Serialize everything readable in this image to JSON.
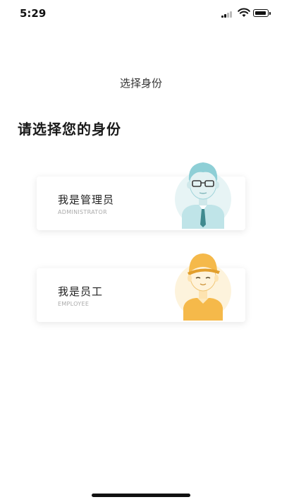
{
  "status_bar": {
    "time": "5:29"
  },
  "nav": {
    "title": "选择身份"
  },
  "heading": "请选择您的身份",
  "cards": [
    {
      "title": "我是管理员",
      "subtitle": "ADMINISTRATOR",
      "icon": "administrator-avatar-icon"
    },
    {
      "title": "我是员工",
      "subtitle": "EMPLOYEE",
      "icon": "employee-avatar-icon"
    }
  ],
  "colors": {
    "admin_accent": "#8ecfd6",
    "employee_accent": "#f5b94a"
  }
}
